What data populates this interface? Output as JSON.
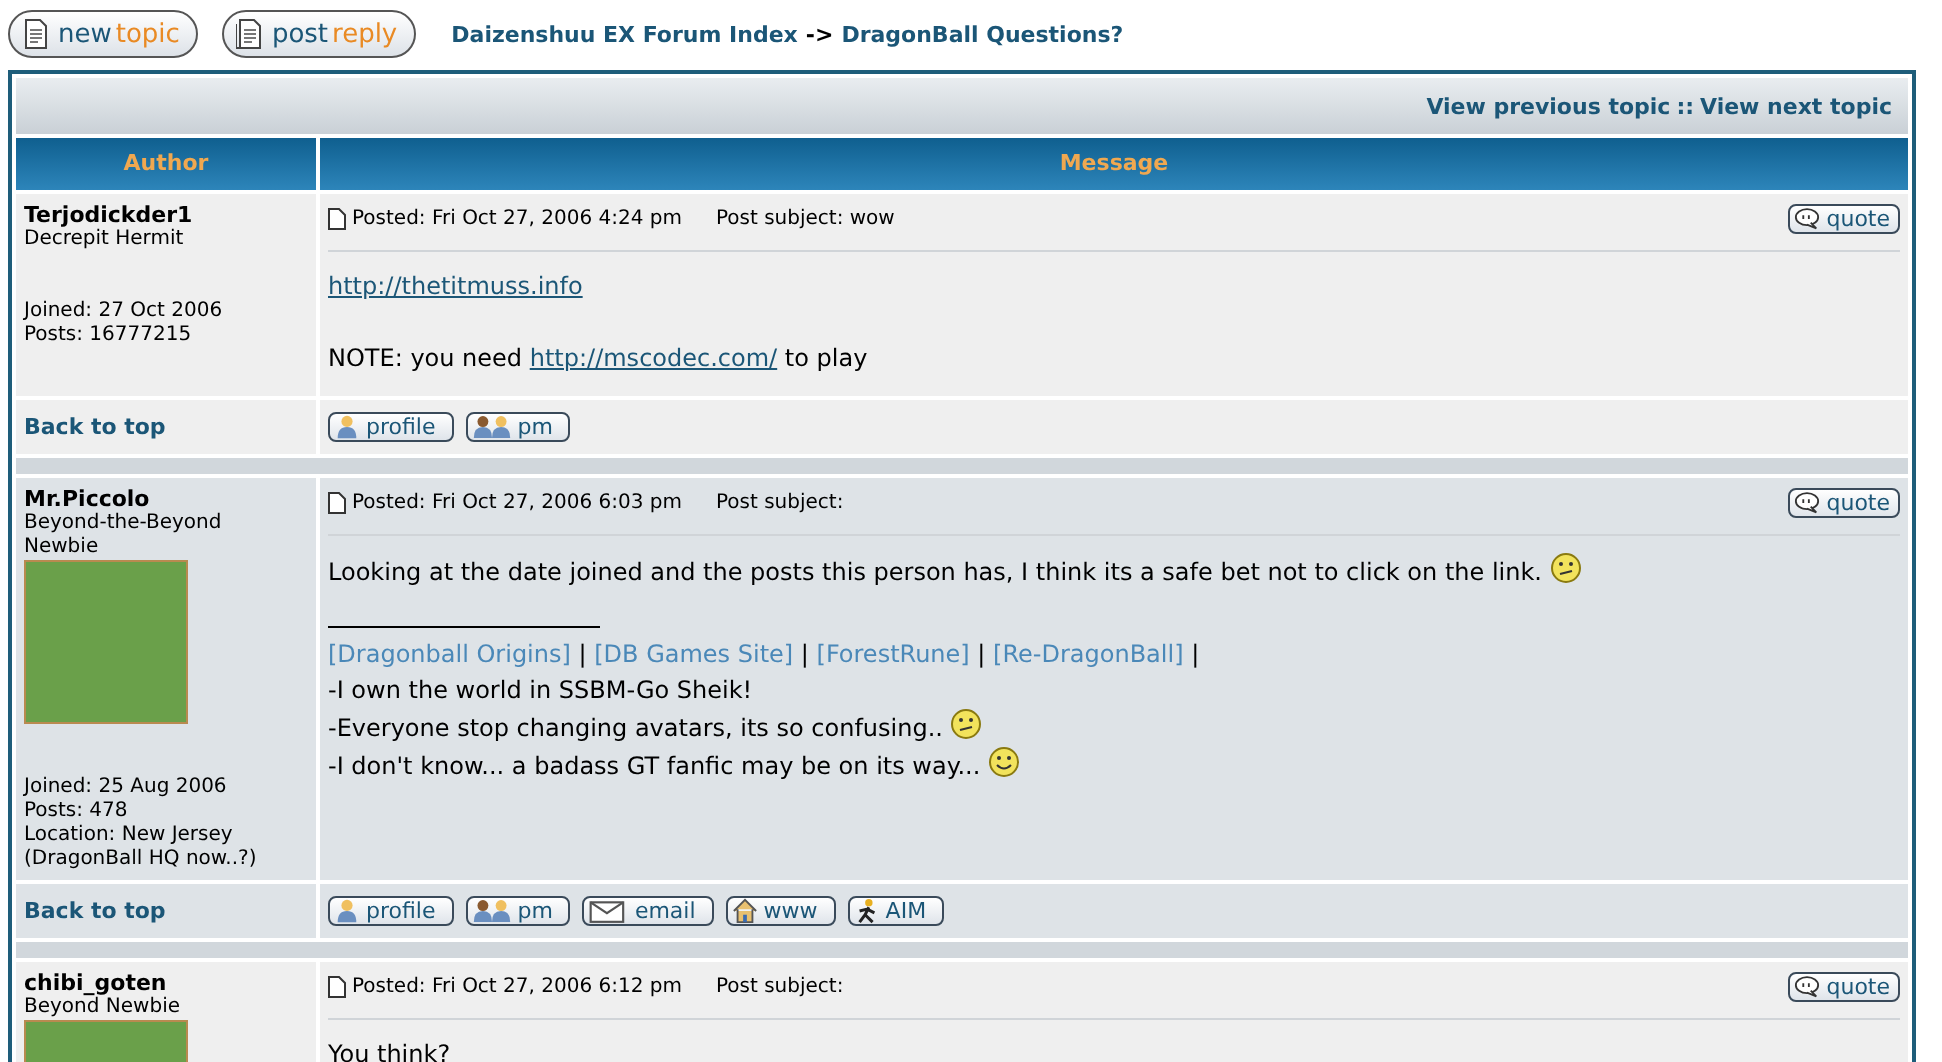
{
  "toolbar": {
    "buttons": [
      {
        "kind": "new",
        "parts": [
          "new",
          "topic"
        ]
      },
      {
        "kind": "reply",
        "parts": [
          "post",
          "reply"
        ]
      }
    ],
    "breadcrumb": {
      "index": "Daizenshuu EX Forum Index",
      "separator": "->",
      "forum": "DragonBall Questions?"
    }
  },
  "topic_nav": {
    "previous": "View previous topic",
    "separator": "::",
    "next": "View next topic"
  },
  "columns": [
    "Author",
    "Message"
  ],
  "posts": [
    {
      "author": "Terjodickder1",
      "rank": "Decrepit Hermit",
      "avatar": false,
      "details": [
        "Joined: 27 Oct 2006",
        "Posts: 16777215"
      ],
      "posted": "Posted: Fri Oct 27, 2006 4:24 pm",
      "subject_label": "Post subject:",
      "subject": "wow",
      "quote": "quote",
      "body": [
        {
          "kind": "para",
          "segments": [
            {
              "kind": "link",
              "text": "http://thetitmuss.info"
            }
          ]
        },
        {
          "kind": "gap"
        },
        {
          "kind": "para",
          "segments": [
            {
              "kind": "text",
              "text": "NOTE: you need "
            },
            {
              "kind": "link",
              "text": "http://mscodec.com/"
            },
            {
              "kind": "text",
              "text": " to play"
            }
          ]
        }
      ],
      "back_to_top": "Back to top",
      "actions": [
        {
          "kind": "profile",
          "label": "profile"
        },
        {
          "kind": "pm",
          "label": "pm"
        }
      ]
    },
    {
      "author": "Mr.Piccolo",
      "rank": "Beyond-the-Beyond Newbie",
      "avatar": true,
      "details": [
        "Joined: 25 Aug 2006",
        "Posts: 478",
        "Location: New Jersey (DragonBall HQ now..?)"
      ],
      "posted": "Posted: Fri Oct 27, 2006 6:03 pm",
      "subject_label": "Post subject:",
      "quote": "quote",
      "body": [
        {
          "kind": "para",
          "segments": [
            {
              "kind": "text",
              "text": "Looking at the date joined and the posts this person has, I think its a safe bet not to click on the link."
            },
            {
              "kind": "confused-smiley"
            }
          ]
        },
        {
          "kind": "gap"
        },
        {
          "kind": "rule"
        },
        {
          "kind": "para",
          "segments": [
            {
              "kind": "sig-link",
              "text": "[Dragonball Origins]"
            },
            {
              "kind": "text",
              "text": " | "
            },
            {
              "kind": "sig-link",
              "text": "[DB Games Site]"
            },
            {
              "kind": "text",
              "text": " | "
            },
            {
              "kind": "sig-link",
              "text": "[ForestRune]"
            },
            {
              "kind": "text",
              "text": " | "
            },
            {
              "kind": "sig-link",
              "text": "[Re-DragonBall]"
            },
            {
              "kind": "text",
              "text": " |"
            }
          ]
        },
        {
          "kind": "para",
          "segments": [
            {
              "kind": "text",
              "text": "-I own the world in SSBM-Go Sheik!"
            }
          ]
        },
        {
          "kind": "para",
          "segments": [
            {
              "kind": "text",
              "text": "-Everyone stop changing avatars, its so confusing.."
            },
            {
              "kind": "confused-smiley"
            }
          ]
        },
        {
          "kind": "para",
          "segments": [
            {
              "kind": "text",
              "text": "-I don't know... a badass GT fanfic may be on its way..."
            },
            {
              "kind": "smiley"
            }
          ]
        }
      ],
      "back_to_top": "Back to top",
      "actions": [
        {
          "kind": "profile",
          "label": "profile"
        },
        {
          "kind": "pm",
          "label": "pm"
        },
        {
          "kind": "email",
          "label": "email"
        },
        {
          "kind": "www",
          "label": "www"
        },
        {
          "kind": "aim",
          "label": "AIM"
        }
      ]
    },
    {
      "author": "chibi_goten",
      "rank": "Beyond Newbie",
      "avatar": true,
      "posted": "Posted: Fri Oct 27, 2006 6:12 pm",
      "subject_label": "Post subject:",
      "quote": "quote",
      "body": [
        {
          "kind": "para",
          "segments": [
            {
              "kind": "text",
              "text": "You think?"
            }
          ]
        }
      ]
    }
  ]
}
